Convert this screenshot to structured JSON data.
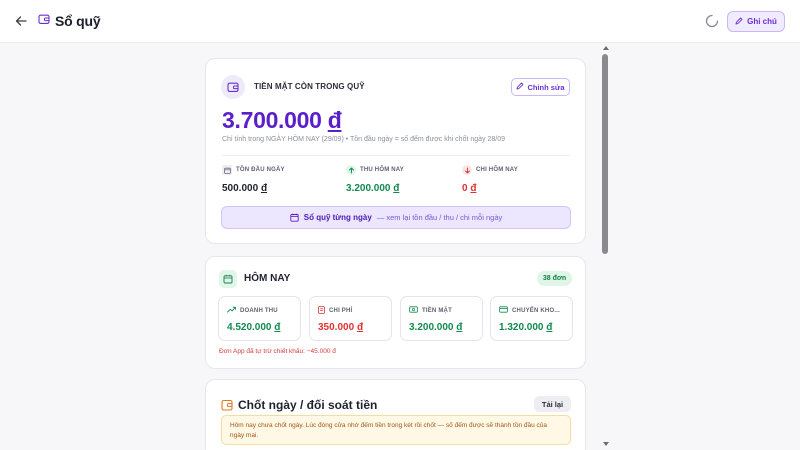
{
  "header": {
    "title": "Sổ quỹ",
    "note_label": "Ghi chú"
  },
  "cash_card": {
    "heading": "TIỀN MẶT CÒN TRONG QUỸ",
    "edit_label": "Chỉnh sửa",
    "amount": "3.700.000",
    "currency": "đ",
    "subtitle": "Chỉ tính trong NGÀY HÔM NAY (29/09) • Tồn đầu ngày = số đếm được khi chốt ngày 28/09",
    "stats": [
      {
        "label": "TỒN ĐẦU NGÀY",
        "value": "500.000",
        "currency": "đ",
        "color": "#1f2330",
        "icon": "calendar-icon"
      },
      {
        "label": "THU HÔM NAY",
        "value": "3.200.000",
        "currency": "đ",
        "color": "#128a4f",
        "icon": "arrow-up-icon"
      },
      {
        "label": "CHI HÔM NAY",
        "value": "0",
        "currency": "đ",
        "color": "#e03131",
        "icon": "arrow-down-icon"
      }
    ],
    "ledger_button": {
      "main": "Sổ quỹ từng ngày",
      "sub": "— xem lại tồn đầu / thu / chi mỗi ngày"
    }
  },
  "today_card": {
    "title": "HÔM NAY",
    "orders_badge": "38 đơn",
    "metrics": [
      {
        "label": "DOANH THU",
        "value": "4.520.000",
        "currency": "đ",
        "color": "#128a4f",
        "icon": "trend-up-icon"
      },
      {
        "label": "CHI PHÍ",
        "value": "350.000",
        "currency": "đ",
        "color": "#e03131",
        "icon": "receipt-icon"
      },
      {
        "label": "TIỀN MẶT",
        "value": "3.200.000",
        "currency": "đ",
        "color": "#128a4f",
        "icon": "cash-icon"
      },
      {
        "label": "CHUYỂN KHO...",
        "value": "1.320.000",
        "currency": "đ",
        "color": "#128a4f",
        "icon": "card-icon"
      }
    ],
    "note": "Đơn App đã tự trừ chiết khấu: −45.000 đ"
  },
  "closing_card": {
    "title": "Chốt ngày / đối soát tiền",
    "reload_label": "Tải lại",
    "warning": "Hôm nay chưa chốt ngày. Lúc đóng cửa nhớ đếm tiền trong két rồi chốt — số đếm được sẽ thành tồn đầu của ngày mai."
  },
  "colors": {
    "accent": "#5b1fc9",
    "positive": "#128a4f",
    "negative": "#e03131"
  }
}
